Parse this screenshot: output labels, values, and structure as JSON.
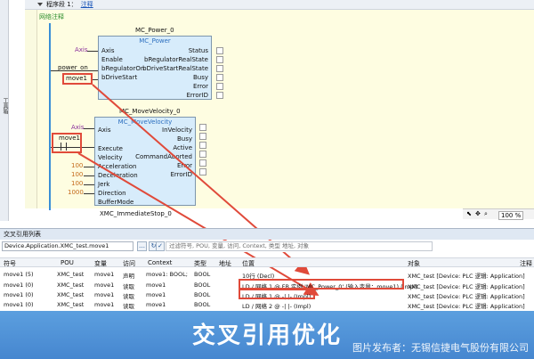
{
  "left_strip": {
    "label": "工具箱"
  },
  "program": {
    "title": "程序段 1：",
    "link": "注释"
  },
  "network": {
    "comment": "网络注释"
  },
  "mc_power": {
    "instance": "MC_Power_0",
    "type": "MC_Power",
    "inputs": [
      "Axis",
      "Enable",
      "bRegulatorOn",
      "bDriveStart"
    ],
    "outputs": [
      "Status",
      "bRegulatorRealState",
      "bDriveStartRealState",
      "Busy",
      "Error",
      "ErrorID"
    ],
    "var_axis": "Axis",
    "var_power_on": "power_on",
    "var_move1": "move1"
  },
  "mc_move": {
    "instance": "MC_MoveVelocity_0",
    "type": "MC_MoveVelocity",
    "inputs": [
      "Axis",
      "Execute",
      "Velocity",
      "Acceleration",
      "Deceleration",
      "Jerk",
      "Direction",
      "BufferMode"
    ],
    "outputs": [
      "InVelocity",
      "Busy",
      "Active",
      "CommandAborted",
      "Error",
      "ErrorID"
    ],
    "var_axis": "Axis",
    "var_move1": "move1",
    "values": [
      "100",
      "100",
      "100",
      "1000"
    ]
  },
  "next_block": {
    "instance": "XMC_ImmediateStop_0"
  },
  "zoom": {
    "value": "100 %"
  },
  "xref": {
    "title": "交叉引用列表",
    "input_value": "Device.Application.XMC_test.move1",
    "filter_placeholder": "过滤符号, POU, 变量, 访问, Context, 类型 地址, 对象",
    "headers": [
      "符号",
      "POU",
      "变量",
      "访问",
      "Context",
      "类型",
      "地址",
      "位置",
      "对象",
      "注释"
    ],
    "rows": [
      [
        "move1 (5)",
        "XMC_test",
        "move1",
        "声明",
        "move1: BOOL;",
        "BOOL",
        "",
        "10行 (Decl)",
        "XMC_test [Device: PLC 逻辑: Application]",
        ""
      ],
      [
        "move1 (0)",
        "XMC_test",
        "move1",
        "读取",
        "move1",
        "BOOL",
        "",
        "LD / 网络 1 @ FB 实例 'MC_Power_0' (输入变量：move1) (Impl)",
        "XMC_test [Device: PLC 逻辑: Application]",
        ""
      ],
      [
        "move1 (0)",
        "XMC_test",
        "move1",
        "读取",
        "move1",
        "BOOL",
        "",
        "LD / 网络 1 @ -| |- (Impl)",
        "XMC_test [Device: PLC 逻辑: Application]",
        ""
      ],
      [
        "move1 (0)",
        "XMC_test",
        "move1",
        "读取",
        "move1",
        "BOOL",
        "",
        "LD / 网络 2 @ -| |- (Impl)",
        "XMC_test [Device: PLC 逻辑: Application]",
        ""
      ]
    ]
  },
  "banner": {
    "title": "交叉引用优化",
    "credit": "图片发布者：无锡信捷电气股份有限公司"
  },
  "colors": {
    "accent_red": "#e04a3a",
    "fb_fill": "#d7ecfb",
    "network_bg": "#fefde1",
    "banner": "#4e97dc"
  }
}
